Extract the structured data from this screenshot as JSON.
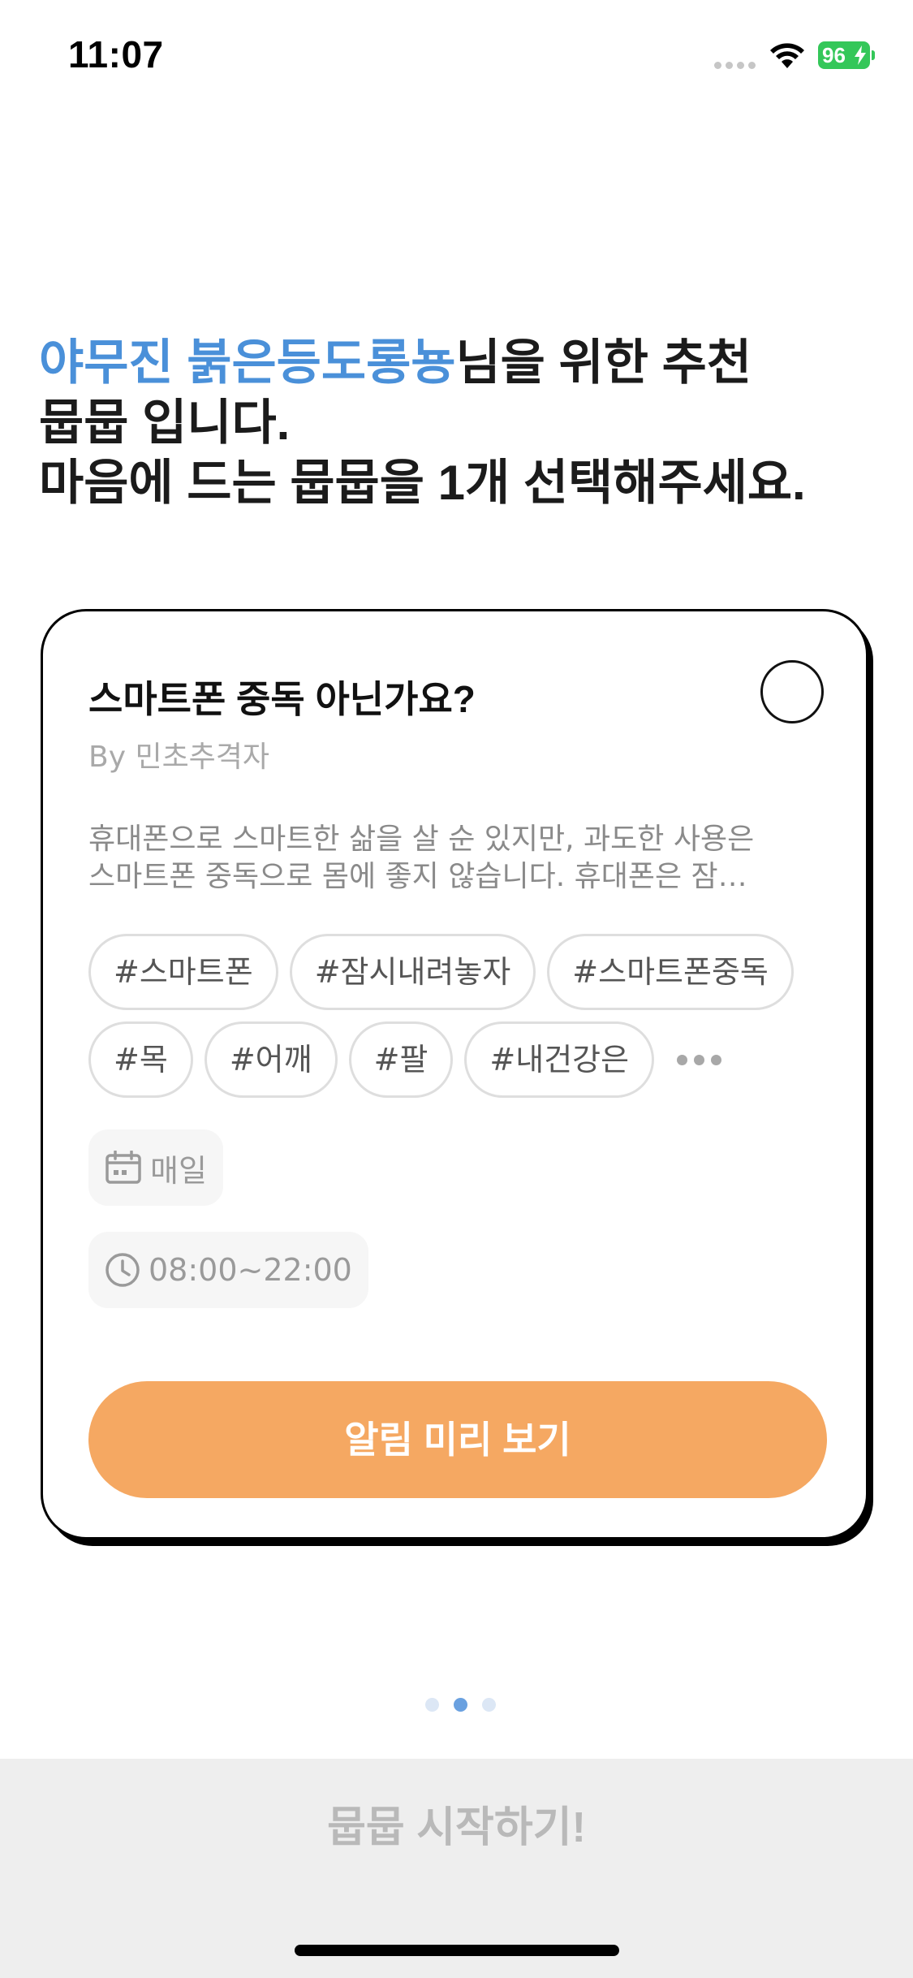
{
  "status_bar": {
    "time": "11:07",
    "battery": "96",
    "battery_color": "#34c759"
  },
  "heading": {
    "nickname": "야무진 붉은등도롱뇽",
    "line1_suffix": "님을 위한 추천",
    "line2": "뭅뭅 입니다.",
    "line3": "마음에 드는 뭅뭅을 1개 선택해주세요.",
    "accent_color": "#4a90d9"
  },
  "card": {
    "title": "스마트폰 중독 아닌가요?",
    "author": "By 민초추격자",
    "description_line1": "휴대폰으로 스마트한 삶을 살 순 있지만, 과도한 사용은",
    "description_line2": "스마트폰 중독으로 몸에 좋지 않습니다. 휴대폰은 잠…",
    "tags_row1": [
      "#스마트폰",
      "#잠시내려놓자",
      "#스마트폰중독"
    ],
    "tags_row2": [
      "#목",
      "#어깨",
      "#팔",
      "#내건강은"
    ],
    "schedule_days": "매일",
    "schedule_time": "08:00~22:00",
    "preview_button": "알림 미리 보기",
    "preview_button_color": "#f5a862"
  },
  "pager": {
    "count": 3,
    "active_index": 1
  },
  "start_button": "뭅뭅 시작하기!"
}
